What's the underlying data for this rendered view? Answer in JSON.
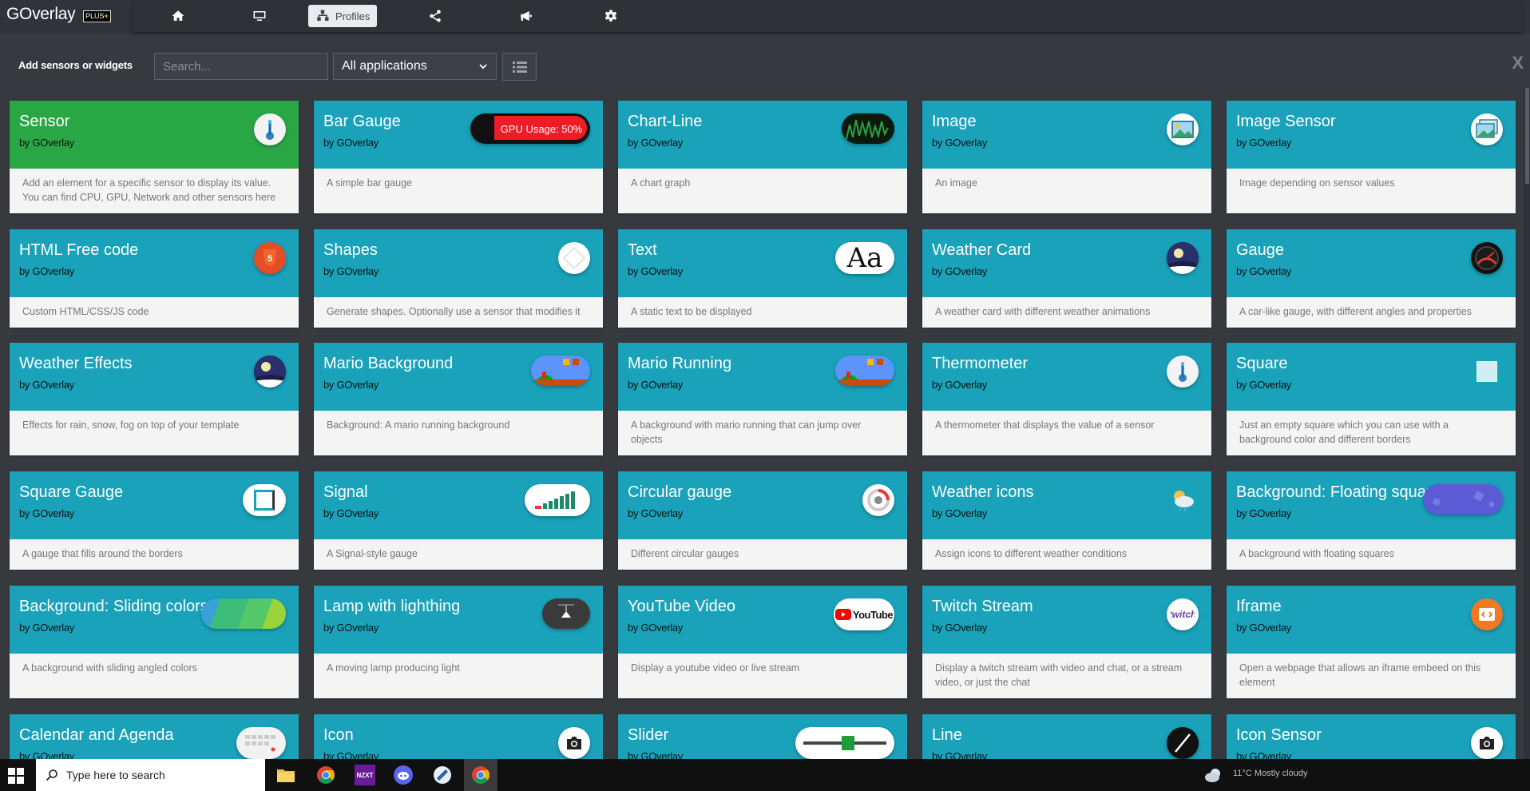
{
  "app": {
    "title": "GOverlay",
    "badge_prefix": "PLUS",
    "badge_suffix": "+"
  },
  "nav": {
    "items": [
      {
        "name": "home",
        "icon": "home-icon"
      },
      {
        "name": "monitor",
        "icon": "monitor-icon"
      },
      {
        "name": "profiles",
        "icon": "sitemap-icon",
        "label": "Profiles",
        "active": true
      },
      {
        "name": "share",
        "icon": "share-icon"
      },
      {
        "name": "announce",
        "icon": "megaphone-icon"
      },
      {
        "name": "settings",
        "icon": "gear-icon"
      }
    ]
  },
  "toolbar": {
    "label": "Add sensors or widgets",
    "search_placeholder": "Search...",
    "filter_value": "All applications",
    "close_label": "X"
  },
  "cards": [
    {
      "title": "Sensor",
      "by": "by GOverlay",
      "desc": "Add an element for a specific sensor to display its value. You can find CPU, GPU, Network and other sensors here",
      "icon": "thermometer-icon",
      "green": true
    },
    {
      "title": "Bar Gauge",
      "by": "by GOverlay",
      "desc": "A simple bar gauge",
      "icon": "bar-gauge-preview",
      "preview_text": "GPU Usage: 50%"
    },
    {
      "title": "Chart-Line",
      "by": "by GOverlay",
      "desc": "A chart graph",
      "icon": "chart-line-preview"
    },
    {
      "title": "Image",
      "by": "by GOverlay",
      "desc": "An image",
      "icon": "image-icon"
    },
    {
      "title": "Image Sensor",
      "by": "by GOverlay",
      "desc": "Image depending on sensor values",
      "icon": "images-icon"
    },
    {
      "title": "HTML Free code",
      "by": "by GOverlay",
      "desc": "Custom HTML/CSS/JS code",
      "icon": "html5-icon"
    },
    {
      "title": "Shapes",
      "by": "by GOverlay",
      "desc": "Generate shapes. Optionally use a sensor that modifies it",
      "icon": "shapes-icon"
    },
    {
      "title": "Text",
      "by": "by GOverlay",
      "desc": "A static text to be displayed",
      "icon": "text-icon",
      "preview_text": "Aa"
    },
    {
      "title": "Weather Card",
      "by": "by GOverlay",
      "desc": "A weather card with different weather animations",
      "icon": "weather-night-icon"
    },
    {
      "title": "Gauge",
      "by": "by GOverlay",
      "desc": "A car-like gauge, with different angles and properties",
      "icon": "speedometer-icon"
    },
    {
      "title": "Weather Effects",
      "by": "by GOverlay",
      "desc": "Effects for rain, snow, fog on top of your template",
      "icon": "weather-night-icon"
    },
    {
      "title": "Mario Background",
      "by": "by GOverlay",
      "desc": "Background: A mario running background",
      "icon": "mario-preview"
    },
    {
      "title": "Mario Running",
      "by": "by GOverlay",
      "desc": "A background with mario running that can jump over objects",
      "icon": "mario-preview"
    },
    {
      "title": "Thermometer",
      "by": "by GOverlay",
      "desc": "A thermometer that displays the value of a sensor",
      "icon": "thermometer-icon"
    },
    {
      "title": "Square",
      "by": "by GOverlay",
      "desc": "Just an empty square which you can use with a background color and different borders",
      "icon": "square-icon"
    },
    {
      "title": "Square Gauge",
      "by": "by GOverlay",
      "desc": "A gauge that fills around the borders",
      "icon": "square-gauge-icon"
    },
    {
      "title": "Signal",
      "by": "by GOverlay",
      "desc": "A Signal-style gauge",
      "icon": "signal-preview"
    },
    {
      "title": "Circular gauge",
      "by": "by GOverlay",
      "desc": "Different circular gauges",
      "icon": "circular-gauge-icon"
    },
    {
      "title": "Weather icons",
      "by": "by GOverlay",
      "desc": "Assign icons to different weather conditions",
      "icon": "weather-icon"
    },
    {
      "title": "Background: Floating squares",
      "by": "by GOverlay",
      "desc": "A background with floating squares",
      "icon": "floating-squares-preview"
    },
    {
      "title": "Background: Sliding colors",
      "by": "by GOverlay",
      "desc": "A background with sliding angled colors",
      "icon": "sliding-colors-preview"
    },
    {
      "title": "Lamp with lighthing",
      "by": "by GOverlay",
      "desc": "A moving lamp producing light",
      "icon": "lamp-preview"
    },
    {
      "title": "YouTube Video",
      "by": "by GOverlay",
      "desc": "Display a youtube video or live stream",
      "icon": "youtube-logo",
      "preview_text": "YouTube"
    },
    {
      "title": "Twitch Stream",
      "by": "by GOverlay",
      "desc": "Display a twitch stream with video and chat, or a stream video, or just the chat",
      "icon": "twitch-logo"
    },
    {
      "title": "Iframe",
      "by": "by GOverlay",
      "desc": "Open a webpage that allows an iframe embeed on this element",
      "icon": "code-icon"
    },
    {
      "title": "Calendar and Agenda",
      "by": "by GOverlay",
      "desc": "",
      "icon": "calendar-icon"
    },
    {
      "title": "Icon",
      "by": "by GOverlay",
      "desc": "",
      "icon": "camera-icon"
    },
    {
      "title": "Slider",
      "by": "by GOverlay",
      "desc": "",
      "icon": "slider-preview"
    },
    {
      "title": "Line",
      "by": "by GOverlay",
      "desc": "",
      "icon": "line-icon"
    },
    {
      "title": "Icon Sensor",
      "by": "by GOverlay",
      "desc": "",
      "icon": "camera-icon"
    }
  ],
  "taskbar": {
    "search_placeholder": "Type here to search",
    "tray_text": "11°C  Mostly cloudy"
  }
}
